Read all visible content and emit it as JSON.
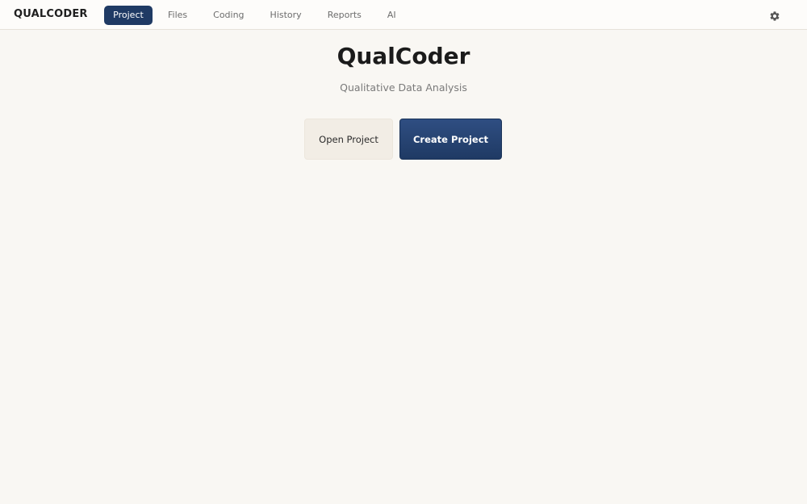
{
  "app": {
    "brand": "QUALCODER"
  },
  "nav": {
    "items": [
      {
        "label": "Project",
        "active": true
      },
      {
        "label": "Files",
        "active": false
      },
      {
        "label": "Coding",
        "active": false
      },
      {
        "label": "History",
        "active": false
      },
      {
        "label": "Reports",
        "active": false
      },
      {
        "label": "AI",
        "active": false
      }
    ],
    "settings_icon": "gear-icon"
  },
  "main": {
    "title": "QualCoder",
    "subtitle": "Qualitative Data Analysis",
    "open_button": "Open Project",
    "create_button": "Create Project"
  },
  "colors": {
    "accent": "#1f3a64",
    "background": "#f9f7f3",
    "secondary_button": "#f2ede5"
  }
}
